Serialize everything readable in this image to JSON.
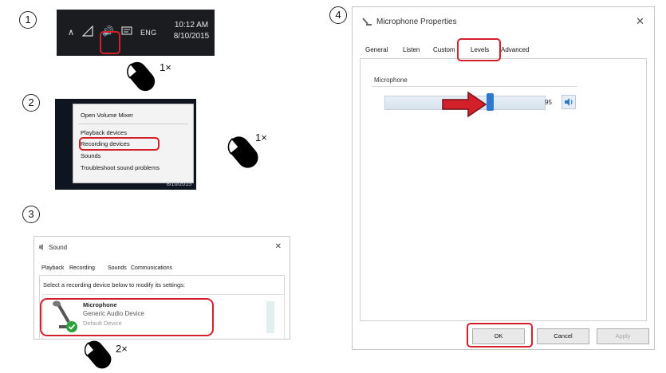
{
  "steps": [
    {
      "number": "1",
      "clicks": "1×"
    },
    {
      "number": "2",
      "clicks": "1×"
    },
    {
      "number": "3",
      "clicks": "2×"
    },
    {
      "number": "4"
    }
  ],
  "taskbar": {
    "language": "ENG",
    "time": "10:12 AM",
    "date": "8/10/2015"
  },
  "context_menu": {
    "items": [
      "Open Volume Mixer",
      "Playback devices",
      "Recording devices",
      "Sounds",
      "Troubleshoot sound problems"
    ],
    "highlighted": "Recording devices",
    "date": "8/10/2015"
  },
  "sound_dialog": {
    "title": "Sound",
    "tabs": [
      "Playback",
      "Recording",
      "Sounds",
      "Communications"
    ],
    "active_tab": "Recording",
    "instruction": "Select a recording device below to modify its settings:",
    "device": {
      "name": "Microphone",
      "description": "Generic Audio Device",
      "status": "Default Device"
    }
  },
  "mic_properties": {
    "title": "Microphone Properties",
    "tabs": [
      "General",
      "Listen",
      "Custom",
      "Levels",
      "Advanced"
    ],
    "active_tab": "Levels",
    "group_label": "Microphone",
    "level": 95,
    "level_text": "95",
    "buttons": {
      "ok": "OK",
      "cancel": "Cancel",
      "apply": "Apply"
    }
  },
  "colors": {
    "highlight": "#d3202a",
    "slider_thumb": "#2f78cf",
    "taskbar": "#1b1c1f"
  }
}
